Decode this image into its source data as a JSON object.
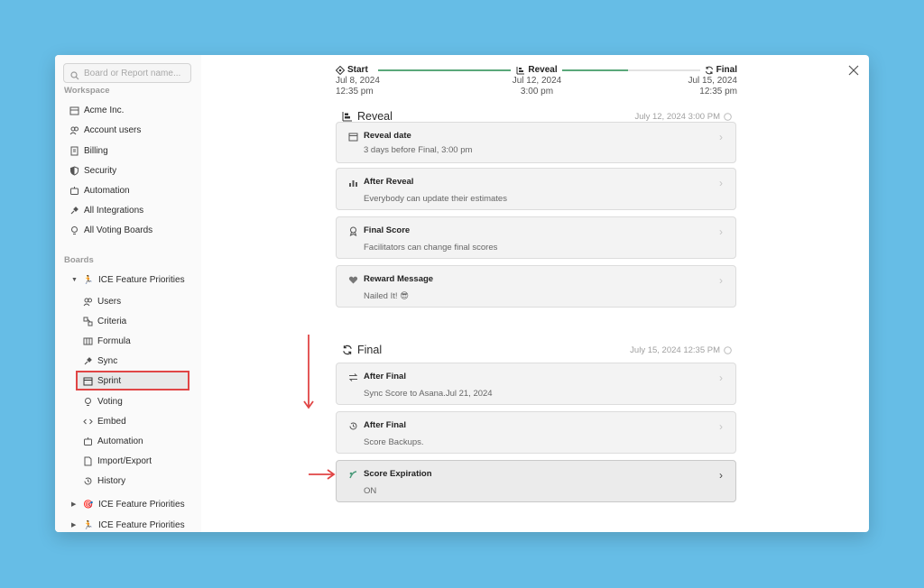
{
  "search": {
    "placeholder": "Board or Report name..."
  },
  "sidebar": {
    "workspace_label": "Workspace",
    "workspace_items": [
      {
        "label": "Acme Inc."
      },
      {
        "label": "Account users"
      },
      {
        "label": "Billing"
      },
      {
        "label": "Security"
      },
      {
        "label": "Automation"
      },
      {
        "label": "All Integrations"
      },
      {
        "label": "All Voting Boards"
      }
    ],
    "boards_label": "Boards",
    "board_main": {
      "label": "ICE Feature Priorities",
      "emoji": "🏃"
    },
    "board_children": [
      {
        "label": "Users"
      },
      {
        "label": "Criteria"
      },
      {
        "label": "Formula"
      },
      {
        "label": "Sync"
      },
      {
        "label": "Sprint"
      },
      {
        "label": "Voting"
      },
      {
        "label": "Embed"
      },
      {
        "label": "Automation"
      },
      {
        "label": "Import/Export"
      },
      {
        "label": "History"
      }
    ],
    "other_boards": [
      {
        "label": "ICE Feature Priorities",
        "emoji": "🎯"
      },
      {
        "label": "ICE Feature Priorities",
        "emoji": "🏃"
      }
    ]
  },
  "timeline": {
    "start": {
      "label": "Start",
      "date": "Jul 8, 2024",
      "time": "12:35 pm"
    },
    "reveal": {
      "label": "Reveal",
      "date": "Jul 12, 2024",
      "time": "3:00 pm"
    },
    "final": {
      "label": "Final",
      "date": "Jul 15, 2024",
      "time": "12:35 pm"
    },
    "progress_color": "#5aa87a"
  },
  "reveal_section": {
    "title": "Reveal",
    "date": "July 12, 2024 3:00 PM",
    "cards": [
      {
        "title": "Reveal date",
        "subtitle": "3 days before Final, 3:00 pm",
        "icon": "calendar-icon"
      },
      {
        "title": "After Reveal",
        "subtitle": "Everybody can update their estimates",
        "icon": "bar-chart-icon"
      },
      {
        "title": "Final Score",
        "subtitle": "Facilitators can change final scores",
        "icon": "medal-icon"
      },
      {
        "title": "Reward Message",
        "subtitle": "Nailed It! 😎",
        "icon": "heart-icon"
      }
    ]
  },
  "final_section": {
    "title": "Final",
    "date": "July 15, 2024 12:35 PM",
    "cards": [
      {
        "title": "After Final",
        "subtitle": "Sync Score to Asana.Jul 21, 2024",
        "icon": "swap-icon"
      },
      {
        "title": "After Final",
        "subtitle": "Score Backups.",
        "icon": "history-icon"
      },
      {
        "title": "Score Expiration",
        "subtitle": "ON",
        "icon": "expiration-icon"
      }
    ]
  },
  "colors": {
    "highlight": "#e04545",
    "background": "#66bde6"
  }
}
